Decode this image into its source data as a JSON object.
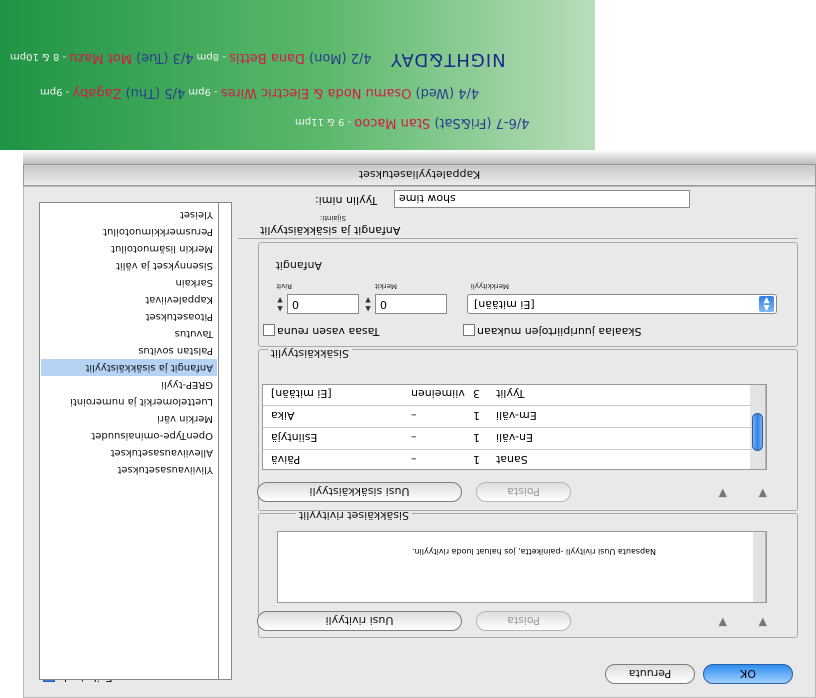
{
  "window": {
    "title": "Kappaletyyliasetukset"
  },
  "preview": {
    "label": "Esikatselu"
  },
  "buttons": {
    "cancel": "Peruuta",
    "ok": "OK"
  },
  "style_name": {
    "label": "Tyylin nimi:",
    "value": "show time",
    "location_label": "Sijainti:"
  },
  "drop_caps_section": {
    "title": "Anfangit ja sisäkkäistyylit",
    "subtitle": "Anfangit",
    "lines_label": "Rivit",
    "lines_value": "0",
    "chars_label": "Merkit",
    "chars_value": "0",
    "char_style_label": "Merkkityyli",
    "char_style_value": "[Ei mitään]",
    "align_left": "Tasaa vasen reuna",
    "scale_descenders": "Skaalaa juuripiirtojen mukaan"
  },
  "nested_styles": {
    "title": "Sisäkkäistyylit",
    "new_button": "Uusi sisäkkäistyyli",
    "delete_button": "Poista",
    "rows": [
      {
        "style": "[Ei mitään]",
        "through": "viimeinen",
        "count": "3",
        "unit": "Tyylit"
      },
      {
        "style": "Aika",
        "through": "–",
        "count": "1",
        "unit": "Em-väli"
      },
      {
        "style": "Esiintyjä",
        "through": "–",
        "count": "1",
        "unit": "En-väli"
      },
      {
        "style": "Päivä",
        "through": "–",
        "count": "1",
        "unit": "Sanat"
      }
    ]
  },
  "nested_lines": {
    "title": "Sisäkkäiset rivityylit",
    "new_button": "Uusi rivityyli",
    "delete_button": "Poista",
    "hint": "Napsauta Uusi rivityyli -painiketta, jos haluat luoda rivityylin."
  },
  "sidebar": {
    "items": [
      {
        "label": "Yleiset",
        "selected": false
      },
      {
        "label": "Perusmerkkimuotoilut",
        "selected": false
      },
      {
        "label": "Merkin lisämuotoilut",
        "selected": false
      },
      {
        "label": "Sisennykset ja välit",
        "selected": false
      },
      {
        "label": "Sarkain",
        "selected": false
      },
      {
        "label": "Kappaleviivat",
        "selected": false
      },
      {
        "label": "Pitoasetukset",
        "selected": false
      },
      {
        "label": "Tavutus",
        "selected": false
      },
      {
        "label": "Palstan sovitus",
        "selected": false
      },
      {
        "label": "Anfangit ja sisäkkäistyylit",
        "selected": true
      },
      {
        "label": "GREP-tyyli",
        "selected": false
      },
      {
        "label": "Luettelomerkit ja numerointi",
        "selected": false
      },
      {
        "label": "Merkin väri",
        "selected": false
      },
      {
        "label": "OpenType-ominaisuudet",
        "selected": false
      },
      {
        "label": "Alleviivausasetukset",
        "selected": false
      },
      {
        "label": "Yliviivausasetukset",
        "selected": false
      }
    ]
  },
  "banner": {
    "logo": "NIGHT&DAY",
    "line1": [
      {
        "text": "4/2 (Mon) ",
        "color": "blue"
      },
      {
        "text": "Dana Bettis",
        "color": "red"
      },
      {
        "text": " - 8pm   ",
        "color": "white"
      },
      {
        "text": "4/3 (Tue) ",
        "color": "blue"
      },
      {
        "text": "Mot Mazu",
        "color": "red"
      },
      {
        "text": " - 8 & 10pm",
        "color": "white"
      }
    ],
    "line2": [
      {
        "text": "4/4 (Wed) ",
        "color": "blue"
      },
      {
        "text": "Osamu Noda & Electric Wires",
        "color": "red"
      },
      {
        "text": " - 9pm   ",
        "color": "white"
      },
      {
        "text": "4/5 (Thu) ",
        "color": "blue"
      },
      {
        "text": "Zagaby",
        "color": "red"
      },
      {
        "text": " - 9pm",
        "color": "white"
      }
    ],
    "line3": [
      {
        "text": "4/6-7 (Fri&Sat) ",
        "color": "blue"
      },
      {
        "text": "Stan Macoo",
        "color": "red"
      },
      {
        "text": " - 9 & 11pm",
        "color": "white"
      }
    ]
  },
  "colors": {
    "accent": "#2f7fe0",
    "selection": "#b6d3f5",
    "banner_green": "#1f9444"
  }
}
